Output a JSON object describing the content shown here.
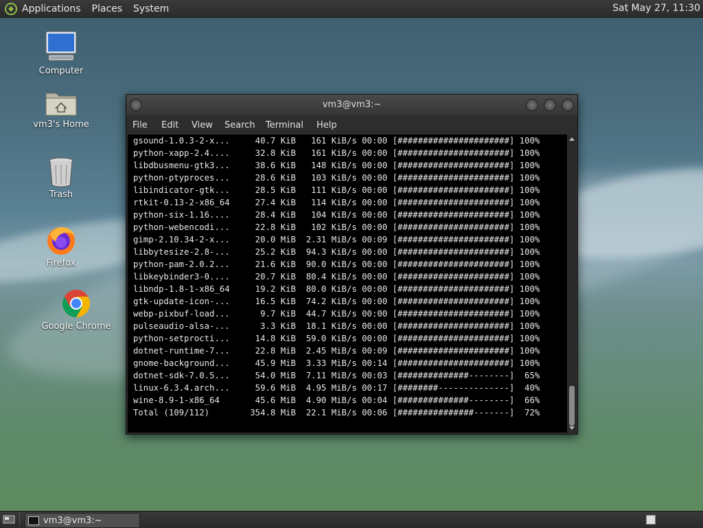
{
  "top_panel": {
    "menus": [
      "Applications",
      "Places",
      "System"
    ],
    "clock": "Sat May 27, 11:30"
  },
  "desktop_icons": [
    {
      "label": "Computer",
      "icon": "computer-icon"
    },
    {
      "label": "vm3's Home",
      "icon": "home-folder-icon"
    },
    {
      "label": "Trash",
      "icon": "trash-icon"
    },
    {
      "label": "Firefox",
      "icon": "firefox-icon"
    },
    {
      "label": "Google Chrome",
      "icon": "chrome-icon"
    }
  ],
  "terminal": {
    "title": "vm3@vm3:~",
    "menus": [
      "File",
      "Edit",
      "View",
      "Search",
      "Terminal",
      "Help"
    ],
    "lines": [
      "gsound-1.0.3-2-x...     40.7 KiB   161 KiB/s 00:00 [######################] 100%",
      "python-xapp-2.4....     32.8 KiB   161 KiB/s 00:00 [######################] 100%",
      "libdbusmenu-gtk3...     38.6 KiB   148 KiB/s 00:00 [######################] 100%",
      "python-ptyproces...     28.6 KiB   103 KiB/s 00:00 [######################] 100%",
      "libindicator-gtk...     28.5 KiB   111 KiB/s 00:00 [######################] 100%",
      "rtkit-0.13-2-x86_64     27.4 KiB   114 KiB/s 00:00 [######################] 100%",
      "python-six-1.16....     28.4 KiB   104 KiB/s 00:00 [######################] 100%",
      "python-webencodi...     22.8 KiB   102 KiB/s 00:00 [######################] 100%",
      "gimp-2.10.34-2-x...     20.0 MiB  2.31 MiB/s 00:09 [######################] 100%",
      "libbytesize-2.8-...     25.2 KiB  94.3 KiB/s 00:00 [######################] 100%",
      "python-pam-2.0.2...     21.6 KiB  90.0 KiB/s 00:00 [######################] 100%",
      "libkeybinder3-0....     20.7 KiB  80.4 KiB/s 00:00 [######################] 100%",
      "libndp-1.8-1-x86_64     19.2 KiB  80.0 KiB/s 00:00 [######################] 100%",
      "gtk-update-icon-...     16.5 KiB  74.2 KiB/s 00:00 [######################] 100%",
      "webp-pixbuf-load...      9.7 KiB  44.7 KiB/s 00:00 [######################] 100%",
      "pulseaudio-alsa-...      3.3 KiB  18.1 KiB/s 00:00 [######################] 100%",
      "python-setprocti...     14.8 KiB  59.0 KiB/s 00:00 [######################] 100%",
      "dotnet-runtime-7...     22.8 MiB  2.45 MiB/s 00:09 [######################] 100%",
      "gnome-background...     45.9 MiB  3.33 MiB/s 00:14 [######################] 100%",
      "dotnet-sdk-7.0.5...     54.0 MiB  7.11 MiB/s 00:03 [##############--------]  65%",
      "linux-6.3.4.arch...     59.6 MiB  4.95 MiB/s 00:17 [########--------------]  40%",
      "wine-8.9-1-x86_64       45.6 MiB  4.90 MiB/s 00:04 [##############--------]  66%",
      "Total (109/112)        354.8 MiB  22.1 MiB/s 00:06 [###############-------]  72%"
    ]
  },
  "bottom_panel": {
    "task_label": "vm3@vm3:~"
  }
}
